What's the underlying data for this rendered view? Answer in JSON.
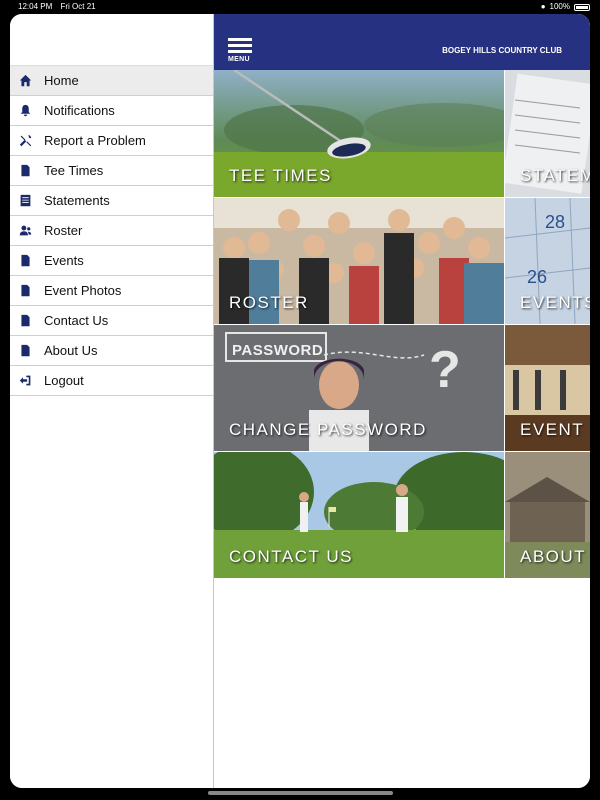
{
  "status": {
    "time": "12:04 PM",
    "date": "Fri Oct 21",
    "battery": "100%"
  },
  "header": {
    "menu_label": "MENU",
    "club_name": "BOGEY HILLS COUNTRY CLUB"
  },
  "drawer": {
    "items": [
      {
        "label": "Home",
        "icon": "home-icon"
      },
      {
        "label": "Notifications",
        "icon": "bell-icon"
      },
      {
        "label": "Report a Problem",
        "icon": "tools-icon"
      },
      {
        "label": "Tee Times",
        "icon": "document-icon"
      },
      {
        "label": "Statements",
        "icon": "statement-icon"
      },
      {
        "label": "Roster",
        "icon": "people-icon"
      },
      {
        "label": "Events",
        "icon": "document-icon"
      },
      {
        "label": "Event Photos",
        "icon": "document-icon"
      },
      {
        "label": "Contact Us",
        "icon": "document-icon"
      },
      {
        "label": "About Us",
        "icon": "document-icon"
      },
      {
        "label": "Logout",
        "icon": "logout-icon"
      }
    ]
  },
  "tiles": {
    "tee_times": "TEE TIMES",
    "statements": "STATEM",
    "roster": "ROSTER",
    "events": "EVENTS",
    "change_password": "CHANGE PASSWORD",
    "event_photos": "EVENT",
    "contact_us": "CONTACT US",
    "about_us": "ABOUT",
    "password_sign": "PASSWORD"
  },
  "colors": {
    "header_bg": "#263181",
    "icon": "#1b2a6b",
    "active_row": "#ececec"
  }
}
